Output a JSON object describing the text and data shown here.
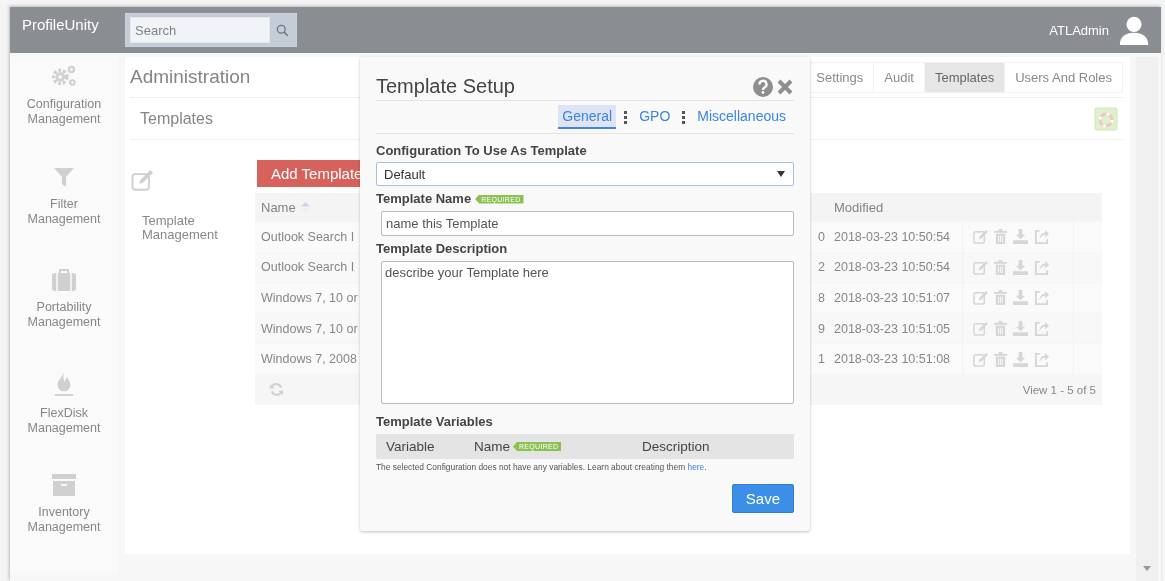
{
  "app": {
    "logo": "ProfileUnity",
    "search": {
      "placeholder": "Search"
    },
    "user": "ATLAdmin"
  },
  "sidebar": {
    "items": [
      {
        "kind": "gears",
        "label": "Configuration Management"
      },
      {
        "kind": "filter",
        "label": "Filter Management"
      },
      {
        "kind": "briefcase",
        "label": "Portability Management"
      },
      {
        "kind": "flame",
        "label": "FlexDisk Management"
      },
      {
        "kind": "archive",
        "label": "Inventory Management"
      }
    ]
  },
  "page": {
    "title": "Administration",
    "tabs": [
      {
        "label": "Settings",
        "selected": false
      },
      {
        "label": "Audit",
        "selected": false
      },
      {
        "label": "Templates",
        "selected": true
      },
      {
        "label": "Users And Roles",
        "selected": false
      }
    ],
    "section": "Templates",
    "side_label": "Template Management"
  },
  "table": {
    "add_button": "Add Template",
    "columns": {
      "name": "Name",
      "modified": "Modified"
    },
    "rows": [
      {
        "name": "Outlook Search I",
        "column_3": "0",
        "modified": "2018-03-23 10:50:54"
      },
      {
        "name": "Outlook Search I",
        "column_3": "2",
        "modified": "2018-03-23 10:50:54"
      },
      {
        "name": "Windows 7, 10 or",
        "column_3": "8",
        "modified": "2018-03-23 10:51:07"
      },
      {
        "name": "Windows 7, 10 or",
        "column_3": "9",
        "modified": "2018-03-23 10:51:05"
      },
      {
        "name": "Windows 7, 2008",
        "column_3": "1",
        "modified": "2018-03-23 10:51:08"
      }
    ],
    "footer": "View 1 - 5 of 5"
  },
  "modal": {
    "title": "Template Setup",
    "tabs": [
      {
        "label": "General",
        "selected": true
      },
      {
        "label": "GPO",
        "selected": false
      },
      {
        "label": "Miscellaneous",
        "selected": false
      }
    ],
    "config": {
      "label": "Configuration To Use As Template",
      "value": "Default"
    },
    "name_field": {
      "label": "Template Name",
      "badge": "REQUIRED",
      "placeholder": "name this Template"
    },
    "description_field": {
      "label": "Template Description",
      "placeholder": "describe your Template here"
    },
    "variables": {
      "title": "Template Variables",
      "columns": [
        {
          "label": "Variable"
        },
        {
          "label": "Name",
          "badge": "REQUIRED"
        },
        {
          "label": "Description"
        }
      ],
      "note": "The selected Configuration does not have any variables. Learn about creating them",
      "link": "here",
      "note_end": "."
    },
    "save": "Save"
  }
}
